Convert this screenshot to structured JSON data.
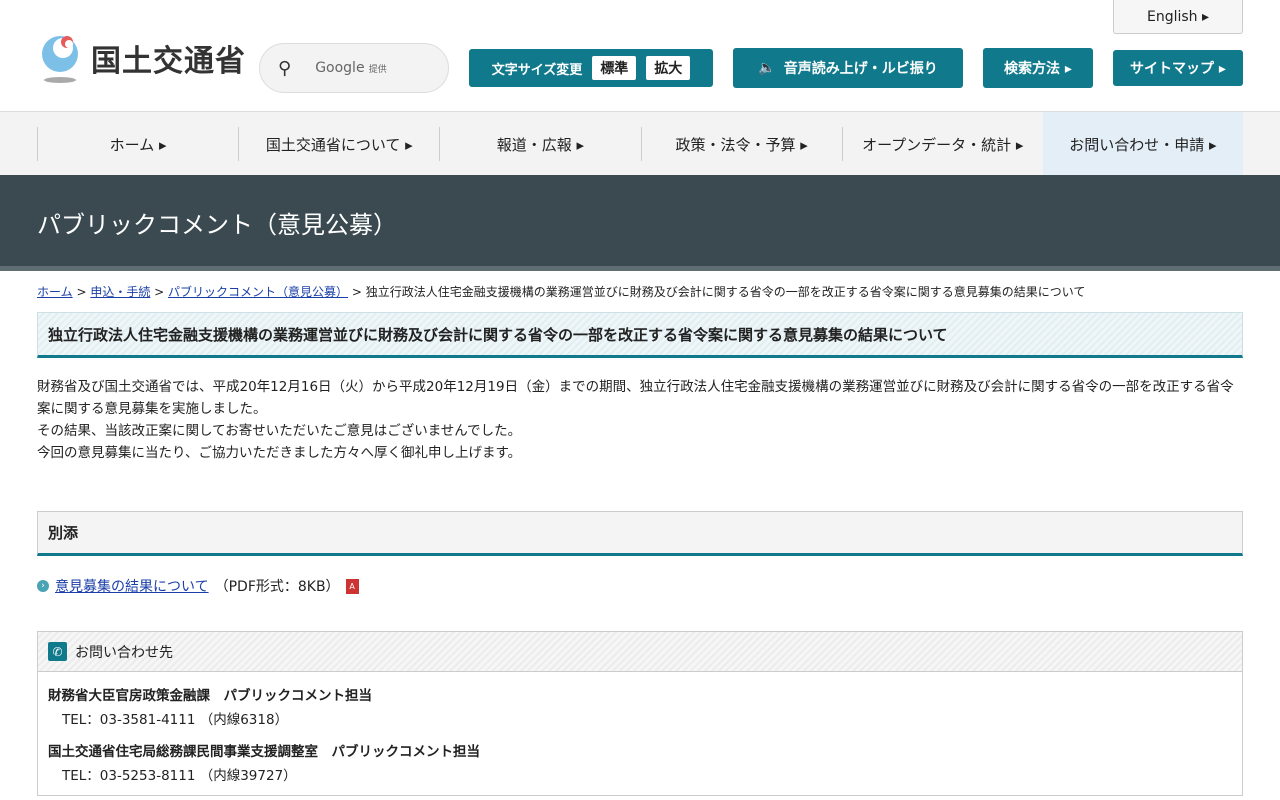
{
  "header": {
    "english": "English ▸",
    "logo_text": "国土交通省",
    "search_label": "Google",
    "search_sub": "提供",
    "font_size_label": "文字サイズ変更",
    "font_standard": "標準",
    "font_large": "拡大",
    "voice": "音声読み上げ・ルビ振り",
    "search_method": "検索方法 ▸",
    "sitemap": "サイトマップ ▸"
  },
  "nav": [
    "ホーム ▸",
    "国土交通省について ▸",
    "報道・広報 ▸",
    "政策・法令・予算 ▸",
    "オープンデータ・統計 ▸",
    "お問い合わせ・申請 ▸"
  ],
  "banner": "パブリックコメント（意見公募）",
  "breadcrumb": {
    "home": "ホーム",
    "apply": "申込・手続",
    "pubcom": "パブリックコメント（意見公募）",
    "current": "独立行政法人住宅金融支援機構の業務運営並びに財務及び会計に関する省令の一部を改正する省令案に関する意見募集の結果について",
    "sep": " > "
  },
  "title": "独立行政法人住宅金融支援機構の業務運営並びに財務及び会計に関する省令の一部を改正する省令案に関する意見募集の結果について",
  "body": [
    "財務省及び国土交通省では、平成20年12月16日（火）から平成20年12月19日（金）までの期間、独立行政法人住宅金融支援機構の業務運営並びに財務及び会計に関する省令の一部を改正する省令案に関する意見募集を実施しました。",
    "その結果、当該改正案に関してお寄せいただいたご意見はございませんでした。",
    "今回の意見募集に当たり、ご協力いただきました方々へ厚く御礼申し上げます。"
  ],
  "attachment": {
    "heading": "別添",
    "link": "意見募集の結果について",
    "info": "（PDF形式：8KB）"
  },
  "contact": {
    "heading": "お問い合わせ先",
    "entries": [
      {
        "org": "財務省大臣官房政策金融課　パブリックコメント担当",
        "tel": "TEL：03-3581-4111 （内線6318）"
      },
      {
        "org": "国土交通省住宅局総務課民間事業支援調整室　パブリックコメント担当",
        "tel": "TEL：03-5253-8111 （内線39727）"
      }
    ]
  }
}
